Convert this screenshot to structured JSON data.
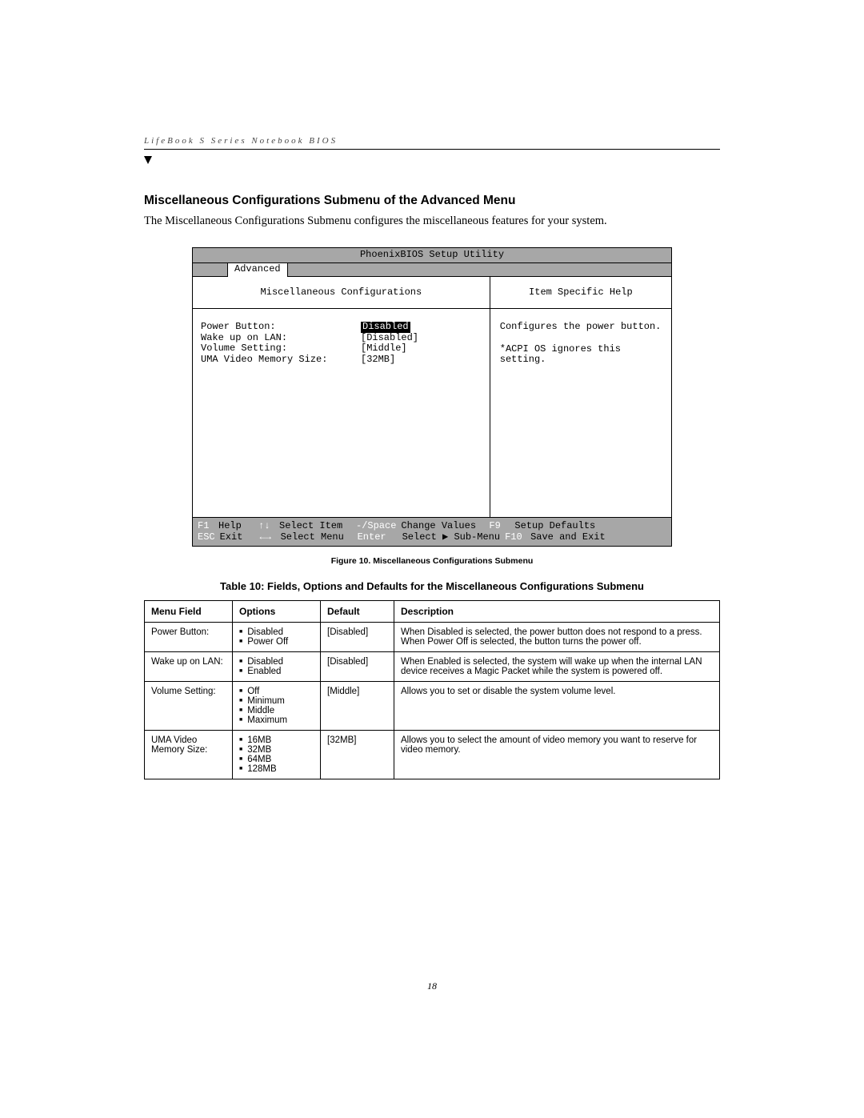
{
  "header": "LifeBook S Series Notebook BIOS",
  "section_title": "Miscellaneous Configurations Submenu of the Advanced Menu",
  "intro": "The Miscellaneous Configurations Submenu configures the miscellaneous features for your system.",
  "bios": {
    "title": "PhoenixBIOS Setup Utility",
    "tab": "Advanced",
    "sub_title": "Miscellaneous Configurations",
    "help_title": "Item Specific Help",
    "settings": [
      {
        "label": "Power Button:",
        "value": "Disabled",
        "selected": true
      },
      {
        "label": "Wake up on LAN:",
        "value": "[Disabled]",
        "selected": false
      },
      {
        "label": "Volume Setting:",
        "value": "[Middle]",
        "selected": false
      },
      {
        "label": "UMA Video Memory Size:",
        "value": "[32MB]",
        "selected": false
      }
    ],
    "help_text1": "Configures the power button.",
    "help_text2": "*ACPI OS ignores this setting.",
    "footer": {
      "f1": "F1",
      "help": "Help",
      "updn": "↑↓",
      "select_item": "Select Item",
      "minus_space": "-/Space",
      "change_values": "Change Values",
      "f9": "F9",
      "setup_defaults": "Setup Defaults",
      "esc": "ESC",
      "exit": "Exit",
      "lr": "←→",
      "select_menu": "Select Menu",
      "enter": "Enter",
      "select_sub": "Select ▶ Sub-Menu",
      "f10": "F10",
      "save_exit": "Save and Exit"
    }
  },
  "figure_caption": "Figure 10.  Miscellaneous Configurations Submenu",
  "table_title": "Table 10: Fields, Options and Defaults for the Miscellaneous Configurations Submenu",
  "table": {
    "headers": {
      "menu": "Menu Field",
      "options": "Options",
      "default": "Default",
      "desc": "Description"
    },
    "rows": [
      {
        "menu": "Power Button:",
        "options": [
          "Disabled",
          "Power Off"
        ],
        "default": "[Disabled]",
        "desc": "When Disabled is selected, the power button does not respond to a press. When Power Off is selected, the button turns the power off."
      },
      {
        "menu": "Wake up on LAN:",
        "options": [
          "Disabled",
          "Enabled"
        ],
        "default": "[Disabled]",
        "desc": "When Enabled is selected, the system will wake up when the internal LAN device receives a Magic Packet while the system is powered off."
      },
      {
        "menu": "Volume Setting:",
        "options": [
          "Off",
          "Minimum",
          "Middle",
          "Maximum"
        ],
        "default": "[Middle]",
        "desc": "Allows you to set or disable the system volume level."
      },
      {
        "menu": "UMA Video Memory Size:",
        "options": [
          "16MB",
          "32MB",
          "64MB",
          "128MB"
        ],
        "default": "[32MB]",
        "desc": "Allows you to select the amount of video memory you want to reserve for video memory."
      }
    ]
  },
  "page_number": "18"
}
